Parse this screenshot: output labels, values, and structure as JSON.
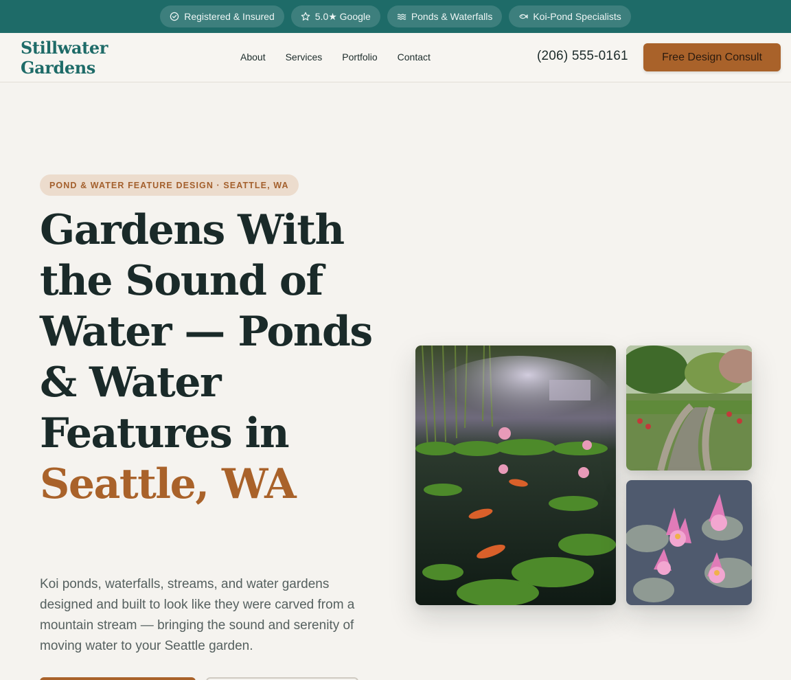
{
  "topbar": {
    "badges": [
      {
        "label": "Registered & Insured",
        "icon": "check-circle-icon"
      },
      {
        "label": "5.0★ Google",
        "icon": "star-icon"
      },
      {
        "label": "Ponds & Waterfalls",
        "icon": "waves-icon"
      },
      {
        "label": "Koi-Pond Specialists",
        "icon": "fish-icon"
      }
    ]
  },
  "header": {
    "logo_line1": "Stillwater",
    "logo_line2": "Gardens",
    "nav": [
      "About",
      "Services",
      "Portfolio",
      "Contact"
    ],
    "phone": "(206) 555-0161",
    "cta": "Free Design Consult"
  },
  "hero": {
    "eyebrow": "POND & WATER FEATURE DESIGN · SEATTLE, WA",
    "headline_main": "Gardens With the Sound of Water — Ponds & Water Features in",
    "headline_accent": "Seattle, WA",
    "lede": "Koi ponds, waterfalls, streams, and water gardens designed and built to look like they were carved from a mountain stream — bringing the sound and serenity of moving water to your Seattle garden."
  },
  "colors": {
    "brand_teal": "#1e6b68",
    "accent_copper": "#a9622a",
    "page_bg": "#f5f3ef",
    "ink": "#1c2b2a"
  },
  "gallery": [
    {
      "subject": "misty koi pond with water lilies"
    },
    {
      "subject": "garden stream with rock edging"
    },
    {
      "subject": "pink water lilies"
    }
  ]
}
